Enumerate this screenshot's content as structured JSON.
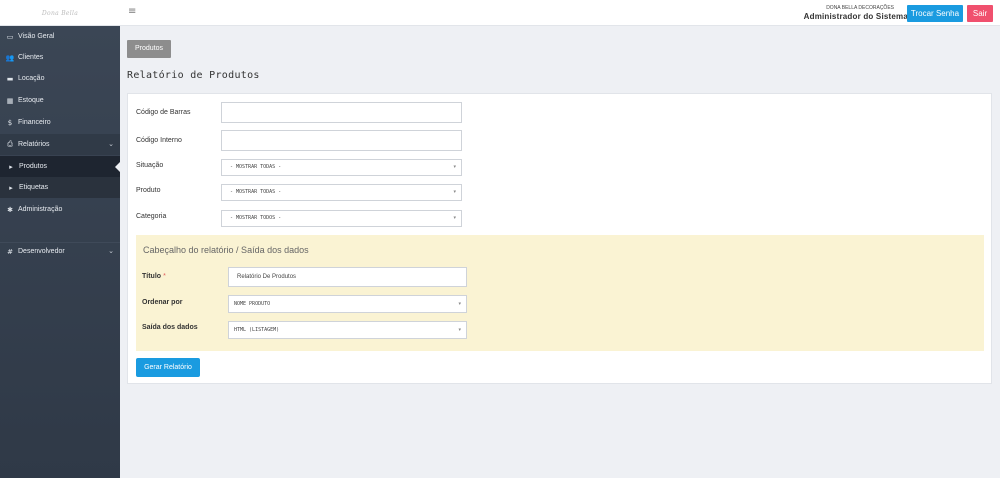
{
  "header": {
    "logo_text": "Dona Bella",
    "menu_icon": "hamburger-icon",
    "menu_glyph": "≡",
    "company": "DONA BELLA DECORAÇÕES",
    "user_role": "Administrador do Sistema",
    "change_password_label": "Trocar Senha",
    "logout_label": "Sair",
    "colors": {
      "primary": "#1a9be0",
      "danger": "#f0506e"
    }
  },
  "sidebar": {
    "items": [
      {
        "label": "Visão Geral",
        "icon": "monitor-icon",
        "glyph": "▭"
      },
      {
        "label": "Clientes",
        "icon": "users-icon",
        "glyph": "👥"
      },
      {
        "label": "Locação",
        "icon": "car-icon",
        "glyph": "▬"
      },
      {
        "label": "Estoque",
        "icon": "grid-icon",
        "glyph": "▦"
      },
      {
        "label": "Financeiro",
        "icon": "dollar-icon",
        "glyph": "$"
      },
      {
        "label": "Relatórios",
        "icon": "printer-icon",
        "glyph": "⎙",
        "chevron": "⌄"
      },
      {
        "label": "Produtos",
        "icon": "caret-right-icon",
        "glyph": "▸"
      },
      {
        "label": "Etiquetas",
        "icon": "caret-right-icon",
        "glyph": "▸"
      },
      {
        "label": "Administração",
        "icon": "gear-icon",
        "glyph": "✱"
      },
      {
        "label": "Desenvolvedor",
        "icon": "hash-icon",
        "glyph": "#",
        "chevron": "⌄"
      }
    ],
    "colors": {
      "background": "#3b4655",
      "active": "#1e2530"
    }
  },
  "main": {
    "breadcrumb": "Produtos",
    "title": "Relatório de Produtos",
    "filters": {
      "barcode_label": "Código de Barras",
      "barcode_value": "",
      "internal_code_label": "Código Interno",
      "internal_code_value": "",
      "status_label": "Situação",
      "status_value": "- MOSTRAR TODAS -",
      "product_label": "Produto",
      "product_value": "- MOSTRAR TODAS -",
      "category_label": "Categoria",
      "category_value": "- MOSTRAR TODOS -"
    },
    "output_panel": {
      "title": "Cabeçalho do relatório / Saída dos dados",
      "title_label": "Título",
      "required_mark": "*",
      "title_value": "Relatório De Produtos",
      "order_label": "Ordenar por",
      "order_value": "NOME PRODUTO",
      "output_label": "Saída dos dados",
      "output_value": "HTML (LISTAGEM)",
      "background": "#faf3d3"
    },
    "generate_label": "Gerar Relatório",
    "dropdown_glyph": "▾"
  }
}
